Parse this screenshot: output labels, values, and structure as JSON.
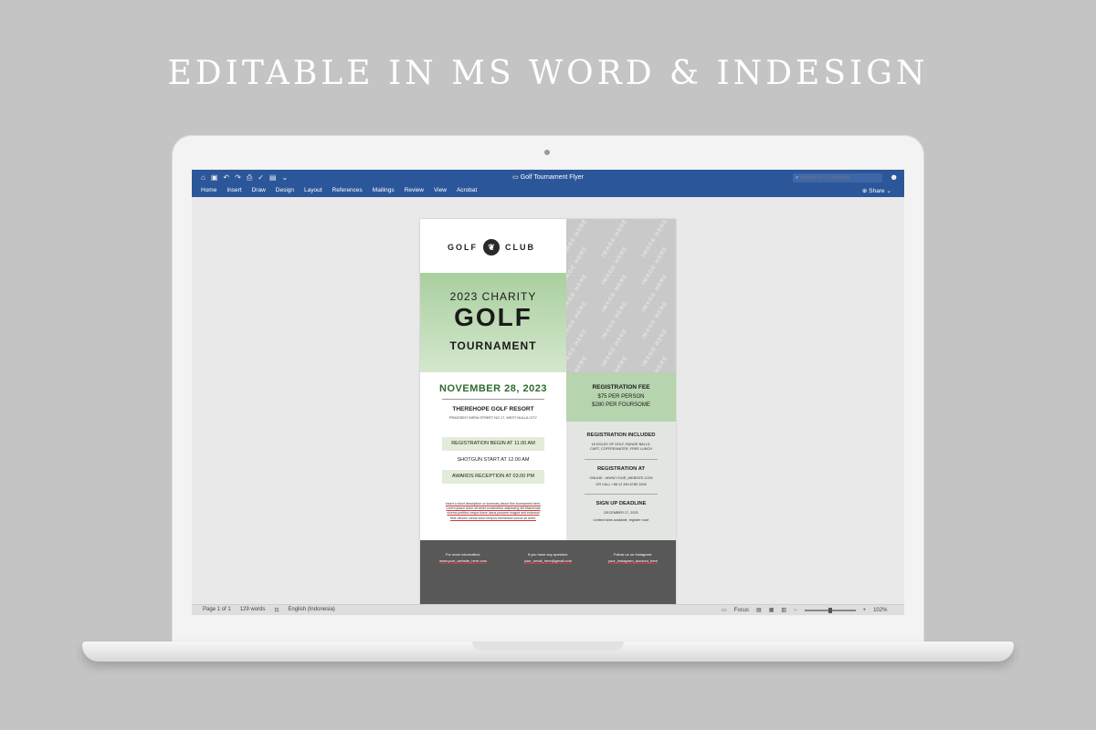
{
  "headline": "EDITABLE IN MS WORD & INDESIGN",
  "app": {
    "doc_title": "Golf Tournament Flyer",
    "search_placeholder": "Search in Document",
    "tabs": [
      "Home",
      "Insert",
      "Draw",
      "Design",
      "Layout",
      "References",
      "Mailings",
      "Review",
      "View",
      "Acrobat"
    ],
    "share_label": "Share",
    "titlebar_icons": [
      "home-icon",
      "save-icon",
      "undo-icon",
      "redo-icon",
      "print-icon",
      "spellcheck-icon",
      "layout-icon",
      "more-icon"
    ],
    "accent": "#2b579a"
  },
  "status": {
    "page": "Page 1 of 1",
    "words": "129 words",
    "language": "English (Indonesia)",
    "focus": "Focus",
    "zoom": "102%",
    "zoom_level_pct": 102
  },
  "flyer": {
    "logo_left": "GOLF",
    "logo_right": "CLUB",
    "image_placeholder": "IMAGE HERE",
    "title_line1": "2023 CHARITY",
    "title_line2": "GOLF",
    "title_line3": "TOURNAMENT",
    "date": "NOVEMBER 28, 2023",
    "venue": "THEREHOPE GOLF RESORT",
    "address": "PRASSENT MERA STREET NO 17, WEST NULLA CITY",
    "schedule": [
      "REGISTRATION BEGIN AT 11.00 AM",
      "SHOTGUN START AT 12.00 AM",
      "AWARDS RECEPTION AT 03.00 PM"
    ],
    "description": "Insert a short description or summary about this tournament here. Lorem ipsum dolor sit amet consectetur adipiscing elit Maecenas viverra porttitor neque fusce lacus posuere magna sed euismod felis ultrices varius dolor tempus fermentum purus sit amet.",
    "reg_fee_title": "REGISTRATION FEE",
    "reg_fee_1": "$75 PER PERSON",
    "reg_fee_2": "$280 PER FOURSOME",
    "included_title": "REGISTRATION INCLUDED",
    "included_text": "18 HOLES OF GOLF, RANGE BALLS, CART, COFFEE/WATER, FREE LUNCH",
    "reg_at_title": "REGISTRATION AT",
    "reg_at_online": "ONLINE : WWW.YOUR_WEBSITE.COM",
    "reg_at_call": "OR CALL +88 12 345 6789 1008",
    "deadline_title": "SIGN UP DEADLINE",
    "deadline_date": "DECEMBER 17, 2023",
    "deadline_note": "Limited slots available, register now!",
    "footer": [
      {
        "label": "For more information:",
        "value": "www.your_website_here.com"
      },
      {
        "label": "If you have any question:",
        "value": "your_email_here@gmail.com"
      },
      {
        "label": "Follow us on Instagram:",
        "value": "your_instagram_account_here"
      }
    ],
    "colors": {
      "green": "#2d6b2d",
      "title_bg": "#a9cf9f",
      "fee_bg": "#b6d4ad",
      "footer_bg": "#585858"
    }
  }
}
